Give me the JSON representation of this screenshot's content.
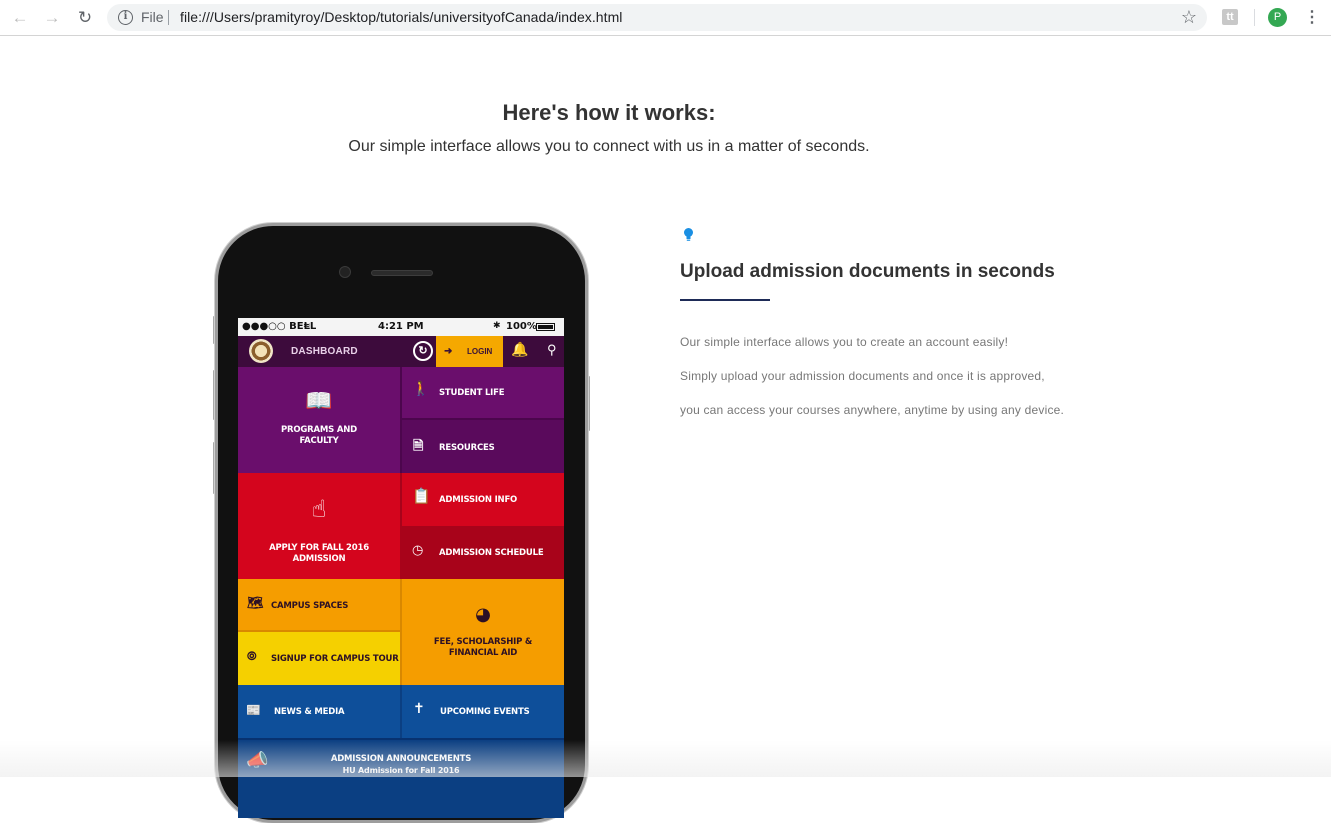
{
  "browser": {
    "scheme_label": "File",
    "url": "file:///Users/pramityroy/Desktop/tutorials/universityofCanada/index.html",
    "avatar_letter": "P",
    "extension_letter": "tt",
    "icons": [
      "back-arrow-icon",
      "forward-arrow-icon",
      "reload-icon",
      "info-icon",
      "star-icon",
      "extension-icon",
      "menu-dots-icon"
    ]
  },
  "page": {
    "heading": "Here's how it works:",
    "subheading": "Our simple interface allows you to connect with us in a matter of seconds."
  },
  "feature": {
    "icon": "lightbulb-icon",
    "accent_color": "#1a8fe3",
    "title": "Upload admission documents in seconds",
    "lines": [
      "Our simple interface allows you to create an account easily!",
      "Simply upload your admission documents and once it is approved,",
      "you can access your courses anywhere, anytime by using any device."
    ]
  },
  "phone_app": {
    "status": {
      "carrier": "●●●○○ BELL",
      "time": "4:21 PM",
      "battery": "100%"
    },
    "appbar": {
      "title": "DASHBOARD",
      "login_label": "LOGIN"
    },
    "tiles": {
      "programs": "PROGRAMS AND FACULTY",
      "student_life": "STUDENT LIFE",
      "resources": "RESOURCES",
      "apply": "APPLY FOR FALL 2016 ADMISSION",
      "admission_info": "ADMISSION INFO",
      "admission_schedule": "ADMISSION SCHEDULE",
      "campus_spaces": "CAMPUS SPACES",
      "signup_tour": "SIGNUP FOR CAMPUS TOUR",
      "fee": "FEE, SCHOLARSHIP & FINANCIAL AID",
      "news": "NEWS & MEDIA",
      "events": "UPCOMING EVENTS",
      "announcements_title": "ADMISSION ANNOUNCEMENTS",
      "announcements_sub": "HU Admission for Fall 2016"
    },
    "colors": {
      "appbar": "#3d0b3c",
      "login": "#f5a800",
      "purple": "#6a0e6c",
      "purple_dark": "#5a0a5c",
      "red": "#d4051d",
      "red_dark": "#a8031a",
      "orange": "#f59d00",
      "yellow": "#f5d000",
      "blue": "#0e4f9a",
      "blue_dark": "#0b3f82"
    }
  }
}
